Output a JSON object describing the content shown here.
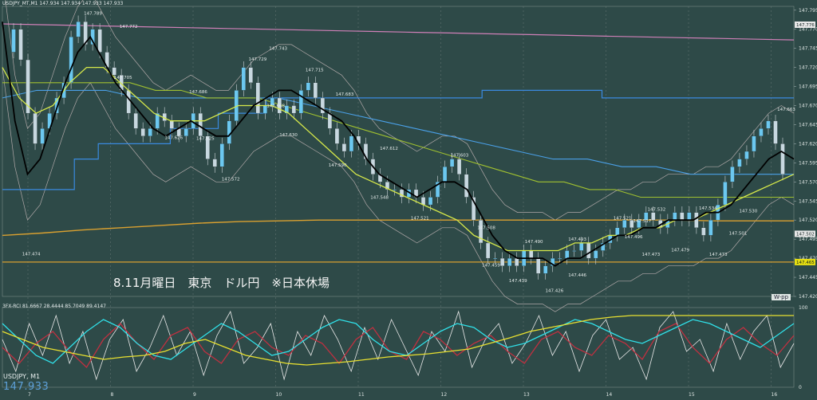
{
  "header": {
    "text": "USDJPY_MT,M1  147.934 147.934 147.933 147.933"
  },
  "indicator_header": {
    "text": "3FX-RCI 81.6667 28.4444 85.7049 89.4147"
  },
  "symbol": {
    "label": "USDJPY, M1",
    "last_price": "147.933"
  },
  "caption": "8.11月曜日　東京　ドル円　※日本休場",
  "badge": "W-pp",
  "colors": {
    "background": "#2e4a48",
    "candle_up": "#6cc8f0",
    "candle_down": "#c8d8e0",
    "sma_fast": "#000000",
    "sma_mid": "#d6e84a",
    "ma_long": "#4aa0e8",
    "ma_pink": "#d080b8",
    "ma_orange": "#d9a030",
    "ichimoku": "#a0c030",
    "rci_red": "#c03040",
    "rci_cyan": "#30e0e8",
    "rci_yellow": "#e8e030",
    "rci_white": "#e8e8e8"
  },
  "chart_data": [
    {
      "type": "candlestick",
      "title": "",
      "ylim": [
        147.42,
        147.8
      ],
      "y_ticks": [
        "147.795",
        "147.770",
        "147.745",
        "147.720",
        "147.695",
        "147.670",
        "147.645",
        "147.620",
        "147.595",
        "147.570",
        "147.545",
        "147.520",
        "147.495",
        "147.470",
        "147.445",
        "147.420"
      ],
      "x_ticks": [
        "7",
        "8",
        "9",
        "10",
        "11",
        "12",
        "13",
        "14",
        "15",
        "16"
      ],
      "price_tags": [
        {
          "value": 147.776,
          "text": "147.776",
          "color": "#e8e8e8"
        },
        {
          "value": 147.502,
          "text": "147.502",
          "color": "#e8e8e8"
        },
        {
          "value": 147.465,
          "text": "147.465",
          "color": "#e8e010"
        }
      ],
      "annotations": [
        {
          "text": "147.789",
          "x": 0.103,
          "y": 147.789
        },
        {
          "text": "147.772",
          "x": 0.148,
          "y": 147.772
        },
        {
          "text": "147.743",
          "x": 0.337,
          "y": 147.743
        },
        {
          "text": "147.729",
          "x": 0.311,
          "y": 147.729
        },
        {
          "text": "147.715",
          "x": 0.383,
          "y": 147.715
        },
        {
          "text": "147.705",
          "x": 0.141,
          "y": 147.705
        },
        {
          "text": "147.686",
          "x": 0.236,
          "y": 147.686
        },
        {
          "text": "147.683",
          "x": 0.421,
          "y": 147.683
        },
        {
          "text": "147.663",
          "x": 0.979,
          "y": 147.663
        },
        {
          "text": "147.668",
          "x": 0.334,
          "y": 147.668
        },
        {
          "text": "147.630",
          "x": 0.35,
          "y": 147.63
        },
        {
          "text": "147.626",
          "x": 0.205,
          "y": 147.626
        },
        {
          "text": "147.625",
          "x": 0.245,
          "y": 147.625
        },
        {
          "text": "147.612",
          "x": 0.477,
          "y": 147.612
        },
        {
          "text": "147.603",
          "x": 0.566,
          "y": 147.603
        },
        {
          "text": "147.590",
          "x": 0.412,
          "y": 147.59
        },
        {
          "text": "147.572",
          "x": 0.277,
          "y": 147.572
        },
        {
          "text": "147.548",
          "x": 0.465,
          "y": 147.548
        },
        {
          "text": "147.532",
          "x": 0.815,
          "y": 147.532
        },
        {
          "text": "147.530",
          "x": 0.931,
          "y": 147.53
        },
        {
          "text": "147.534",
          "x": 0.88,
          "y": 147.534
        },
        {
          "text": "147.521",
          "x": 0.516,
          "y": 147.521
        },
        {
          "text": "147.521",
          "x": 0.772,
          "y": 147.521
        },
        {
          "text": "147.517",
          "x": 0.797,
          "y": 147.517
        },
        {
          "text": "147.508",
          "x": 0.6,
          "y": 147.508
        },
        {
          "text": "147.501",
          "x": 0.918,
          "y": 147.501
        },
        {
          "text": "147.496",
          "x": 0.786,
          "y": 147.496
        },
        {
          "text": "147.493",
          "x": 0.715,
          "y": 147.493
        },
        {
          "text": "147.490",
          "x": 0.66,
          "y": 147.49
        },
        {
          "text": "147.479",
          "x": 0.845,
          "y": 147.479
        },
        {
          "text": "147.474",
          "x": 0.025,
          "y": 147.474
        },
        {
          "text": "147.473",
          "x": 0.808,
          "y": 147.473
        },
        {
          "text": "147.473",
          "x": 0.893,
          "y": 147.473
        },
        {
          "text": "147.459",
          "x": 0.606,
          "y": 147.459
        },
        {
          "text": "147.446",
          "x": 0.715,
          "y": 147.446
        },
        {
          "text": "147.439",
          "x": 0.64,
          "y": 147.439
        },
        {
          "text": "147.426",
          "x": 0.686,
          "y": 147.426
        }
      ],
      "series": [
        {
          "role": "price",
          "key": "price",
          "values": [
            147.74,
            147.77,
            147.73,
            147.66,
            147.62,
            147.64,
            147.66,
            147.68,
            147.7,
            147.76,
            147.78,
            147.75,
            147.77,
            147.74,
            147.72,
            147.71,
            147.69,
            147.66,
            147.64,
            147.63,
            147.64,
            147.66,
            147.65,
            147.64,
            147.63,
            147.64,
            147.66,
            147.63,
            147.6,
            147.59,
            147.62,
            147.65,
            147.69,
            147.72,
            147.7,
            147.66,
            147.67,
            147.68,
            147.66,
            147.67,
            147.66,
            147.69,
            147.7,
            147.68,
            147.66,
            147.64,
            147.62,
            147.61,
            147.63,
            147.62,
            147.6,
            147.58,
            147.57,
            147.56,
            147.56,
            147.55,
            147.56,
            147.55,
            147.54,
            147.55,
            147.57,
            147.59,
            147.6,
            147.58,
            147.55,
            147.52,
            147.49,
            147.47,
            147.47,
            147.46,
            147.47,
            147.46,
            147.48,
            147.47,
            147.45,
            147.46,
            147.47,
            147.47,
            147.48,
            147.48,
            147.49,
            147.47,
            147.48,
            147.49,
            147.5,
            147.51,
            147.52,
            147.51,
            147.52,
            147.53,
            147.52,
            147.51,
            147.52,
            147.53,
            147.52,
            147.53,
            147.51,
            147.5,
            147.52,
            147.54,
            147.57,
            147.59,
            147.6,
            147.61,
            147.63,
            147.64,
            147.65,
            147.62,
            147.58
          ]
        },
        {
          "role": "line",
          "key": "sma_fast",
          "values": [
            147.78,
            147.65,
            147.58,
            147.6,
            147.65,
            147.7,
            147.74,
            147.76,
            147.73,
            147.7,
            147.68,
            147.66,
            147.64,
            147.63,
            147.64,
            147.65,
            147.64,
            147.63,
            147.63,
            147.65,
            147.67,
            147.68,
            147.69,
            147.69,
            147.68,
            147.67,
            147.66,
            147.65,
            147.63,
            147.6,
            147.58,
            147.57,
            147.56,
            147.55,
            147.56,
            147.57,
            147.57,
            147.56,
            147.53,
            147.5,
            147.48,
            147.47,
            147.47,
            147.47,
            147.46,
            147.47,
            147.47,
            147.48,
            147.49,
            147.5,
            147.5,
            147.51,
            147.51,
            147.52,
            147.52,
            147.52,
            147.53,
            147.53,
            147.54,
            147.56,
            147.58,
            147.6,
            147.61,
            147.6
          ]
        },
        {
          "role": "line",
          "key": "sma_mid",
          "values": [
            147.72,
            147.68,
            147.66,
            147.67,
            147.7,
            147.72,
            147.72,
            147.7,
            147.68,
            147.66,
            147.65,
            147.65,
            147.65,
            147.66,
            147.67,
            147.67,
            147.67,
            147.66,
            147.64,
            147.62,
            147.6,
            147.58,
            147.57,
            147.56,
            147.55,
            147.54,
            147.53,
            147.52,
            147.5,
            147.49,
            147.48,
            147.48,
            147.48,
            147.48,
            147.49,
            147.49,
            147.5,
            147.5,
            147.51,
            147.51,
            147.52,
            147.52,
            147.53,
            147.54,
            147.55,
            147.56,
            147.57,
            147.58
          ]
        },
        {
          "role": "line",
          "key": "ichimoku",
          "values": [
            147.7,
            147.7,
            147.7,
            147.7,
            147.7,
            147.7,
            147.69,
            147.69,
            147.68,
            147.68,
            147.68,
            147.67,
            147.66,
            147.65,
            147.64,
            147.63,
            147.62,
            147.61,
            147.6,
            147.59,
            147.58,
            147.57,
            147.57,
            147.56,
            147.56,
            147.55,
            147.55,
            147.55,
            147.55,
            147.55,
            147.55,
            147.55
          ]
        },
        {
          "role": "line",
          "key": "ma_long",
          "values": [
            147.68,
            147.69,
            147.69,
            147.69,
            147.68,
            147.68,
            147.68,
            147.68,
            147.68,
            147.67,
            147.66,
            147.65,
            147.64,
            147.63,
            147.62,
            147.61,
            147.6,
            147.6,
            147.59,
            147.59,
            147.58,
            147.58,
            147.58,
            147.58
          ]
        },
        {
          "role": "line",
          "key": "ma_pink",
          "values": [
            147.777,
            147.776,
            147.775,
            147.774,
            147.773,
            147.772,
            147.771,
            147.77,
            147.769,
            147.768,
            147.767,
            147.766,
            147.765,
            147.764,
            147.763,
            147.762,
            147.761,
            147.76,
            147.759,
            147.758,
            147.757,
            147.756
          ]
        },
        {
          "role": "line",
          "key": "ma_orange",
          "values": [
            147.5,
            147.503,
            147.507,
            147.51,
            147.513,
            147.516,
            147.518,
            147.519,
            147.52,
            147.52,
            147.52,
            147.52,
            147.52,
            147.52,
            147.52,
            147.52,
            147.52,
            147.52,
            147.519,
            147.519,
            147.519
          ]
        },
        {
          "role": "step",
          "key": "ma_long",
          "values": [
            147.56,
            147.56,
            147.56,
            147.6,
            147.62,
            147.62,
            147.62,
            147.64,
            147.64,
            147.66,
            147.66,
            147.68,
            147.68,
            147.68,
            147.68,
            147.68,
            147.68,
            147.68,
            147.68,
            147.68,
            147.69,
            147.69,
            147.69,
            147.69,
            147.69,
            147.68,
            147.68,
            147.68,
            147.68,
            147.68,
            147.68,
            147.68,
            147.68
          ]
        }
      ]
    },
    {
      "type": "line",
      "title": "",
      "ylim": [
        0,
        100
      ],
      "y_ticks": [
        "100",
        "0"
      ],
      "series": [
        {
          "key": "rci_white",
          "values": [
            60,
            20,
            80,
            40,
            90,
            30,
            70,
            10,
            60,
            85,
            20,
            50,
            90,
            40,
            70,
            15,
            65,
            95,
            30,
            50,
            80,
            10,
            70,
            40,
            90,
            60,
            20,
            75,
            35,
            85,
            50,
            15,
            70,
            45,
            95,
            25,
            60,
            80,
            30,
            55,
            90,
            40,
            70,
            20,
            65,
            85,
            35,
            50,
            10,
            75,
            95,
            45,
            60,
            20,
            80,
            35,
            70,
            90,
            25,
            55
          ]
        },
        {
          "key": "rci_red",
          "values": [
            50,
            30,
            55,
            70,
            45,
            25,
            60,
            80,
            55,
            35,
            65,
            75,
            45,
            30,
            60,
            70,
            50,
            40,
            65,
            55,
            30,
            60,
            75,
            45,
            35,
            70,
            60,
            40,
            55,
            65,
            45,
            30,
            60,
            70,
            50,
            40,
            65,
            55,
            35,
            70,
            80,
            50,
            30,
            60,
            75,
            55,
            40,
            65
          ]
        },
        {
          "key": "rci_cyan",
          "values": [
            80,
            60,
            40,
            30,
            50,
            70,
            85,
            75,
            55,
            40,
            35,
            50,
            65,
            80,
            70,
            55,
            40,
            45,
            60,
            75,
            85,
            80,
            60,
            45,
            40,
            55,
            70,
            80,
            75,
            60,
            50,
            55,
            65,
            75,
            85,
            80,
            70,
            60,
            55,
            65,
            75,
            85,
            80,
            70,
            60,
            50,
            65,
            80
          ]
        },
        {
          "key": "rci_yellow",
          "values": [
            70,
            60,
            50,
            45,
            40,
            35,
            38,
            40,
            45,
            55,
            60,
            50,
            40,
            35,
            30,
            28,
            30,
            32,
            35,
            38,
            40,
            42,
            45,
            48,
            55,
            62,
            70,
            75,
            80,
            85,
            88,
            90,
            90,
            90,
            90,
            90,
            90,
            90,
            90,
            90
          ]
        }
      ]
    }
  ]
}
